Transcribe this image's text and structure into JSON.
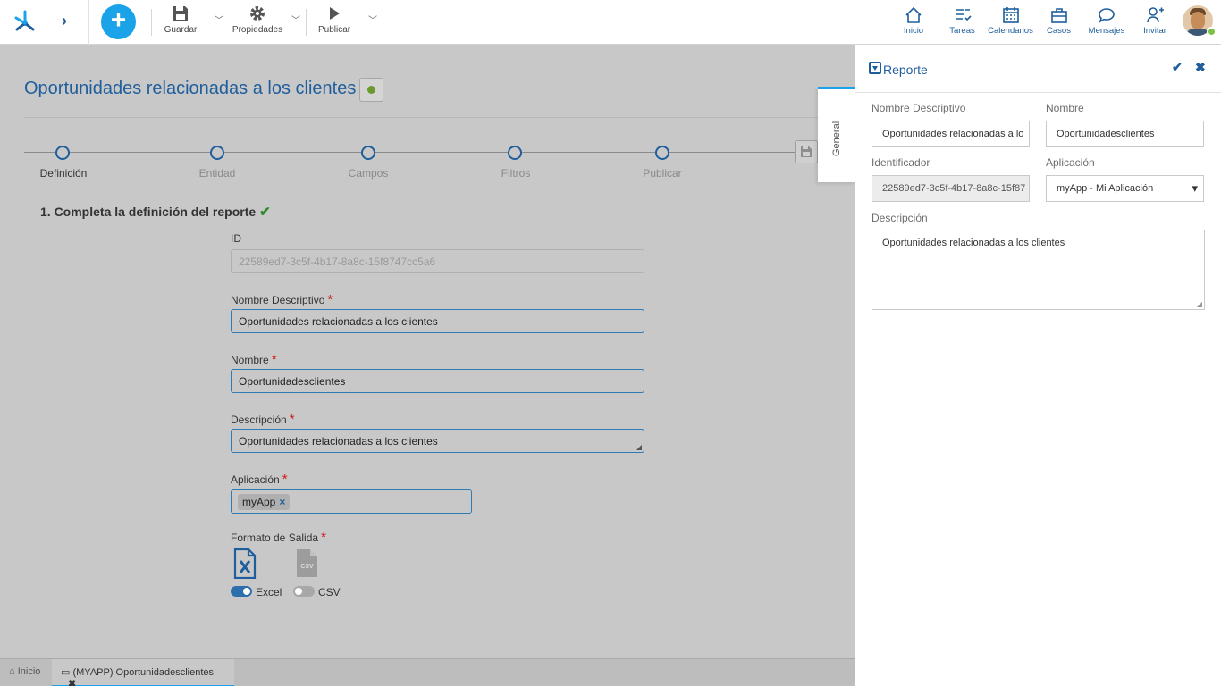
{
  "toolbar": {
    "save_label": "Guardar",
    "properties_label": "Propiedades",
    "publish_label": "Publicar"
  },
  "nav": {
    "home": "Inicio",
    "tasks": "Tareas",
    "calendars": "Calendarios",
    "cases": "Casos",
    "messages": "Mensajes",
    "invite": "Invitar"
  },
  "main": {
    "title": "Oportunidades relacionadas a los clientes",
    "steps": [
      "Definición",
      "Entidad",
      "Campos",
      "Filtros",
      "Publicar"
    ],
    "section_title": "1. Completa la definición del reporte",
    "fields": {
      "id_label": "ID",
      "id_value": "22589ed7-3c5f-4b17-8a8c-15f8747cc5a6",
      "desc_name_label": "Nombre Descriptivo",
      "desc_name_value": "Oportunidades relacionadas a los clientes",
      "name_label": "Nombre",
      "name_value": "Oportunidadesclientes",
      "description_label": "Descripción",
      "description_value": "Oportunidades relacionadas a los clientes",
      "application_label": "Aplicación",
      "application_chip": "myApp",
      "output_label": "Formato de Salida",
      "excel_label": "Excel",
      "csv_label": "CSV",
      "required_mark": "*"
    },
    "excel_enabled": true,
    "csv_enabled": false
  },
  "bottom_tabs": {
    "home": "Inicio",
    "current": "(MYAPP) Oportunidadesclientes"
  },
  "panel": {
    "title": "Reporte",
    "vertical_tab": "General",
    "desc_name_label": "Nombre Descriptivo",
    "desc_name_value": "Oportunidades relacionadas a lo",
    "name_label": "Nombre",
    "name_value": "Oportunidadesclientes",
    "identifier_label": "Identificador",
    "identifier_value": "22589ed7-3c5f-4b17-8a8c-15f87",
    "application_label": "Aplicación",
    "application_value": "myApp - Mi Aplicación",
    "description_label": "Descripción",
    "description_value": "Oportunidades relacionadas a los clientes"
  },
  "colors": {
    "accent": "#1aa3e8",
    "primary": "#1f5e9c",
    "required": "#d01919",
    "success": "#2f8a2f"
  }
}
